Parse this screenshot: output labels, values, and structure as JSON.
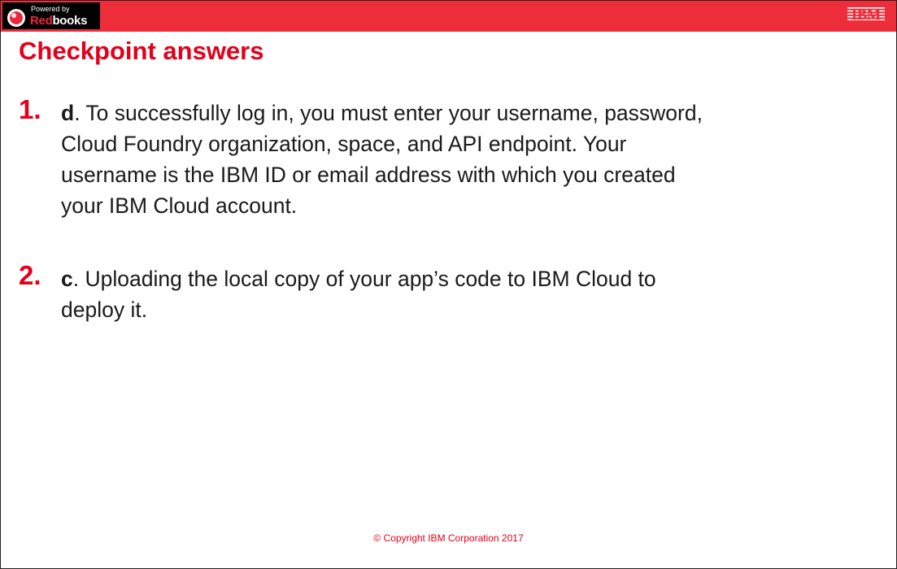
{
  "branding": {
    "powered_by": "Powered by",
    "logo_red": "Red",
    "logo_white": "books",
    "corner_logo": "IBM"
  },
  "title": "Checkpoint answers",
  "items": [
    {
      "number": "1.",
      "answer_letter": "d",
      "lines": [
        ". To successfully log in, you must enter your username, password,",
        "Cloud Foundry organization, space, and API endpoint. Your",
        "username is the IBM ID or email address with which you created",
        "your IBM Cloud account."
      ]
    },
    {
      "number": "2.",
      "answer_letter": "c",
      "lines": [
        ". Uploading the local copy of your app’s code to IBM Cloud to",
        "deploy it."
      ]
    }
  ],
  "footer": {
    "copyright": "© Copyright IBM Corporation 2017"
  },
  "colors": {
    "accent_red": "#e2001a",
    "band_red": "#ee2d3b"
  }
}
